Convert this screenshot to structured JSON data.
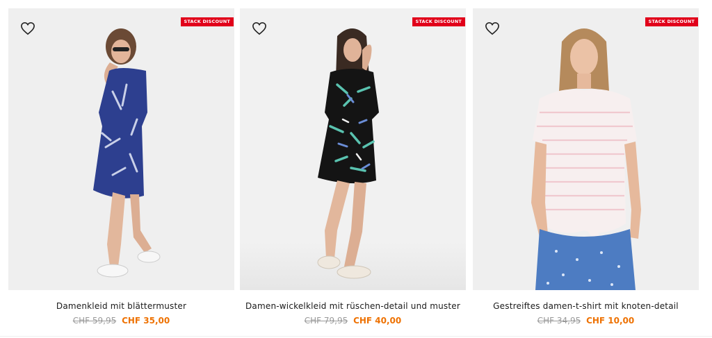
{
  "products": [
    {
      "badge": "STACK DISCOUNT",
      "name": "Damenkleid mit blättermuster",
      "old_price": "CHF 59,95",
      "new_price": "CHF 35,00"
    },
    {
      "badge": "STACK DISCOUNT",
      "name": "Damen-wickelkleid mit rüschen-detail und muster",
      "old_price": "CHF 79,95",
      "new_price": "CHF 40,00"
    },
    {
      "badge": "STACK DISCOUNT",
      "name": "Gestreiftes damen-t-shirt mit knoten-detail",
      "old_price": "CHF 34,95",
      "new_price": "CHF 10,00"
    }
  ],
  "icons": {
    "favorite": "heart-outline-icon"
  },
  "colors": {
    "badge_bg": "#e1001a",
    "sale_price": "#ee7203",
    "old_price": "#999999",
    "photo_bg": "#efefef"
  }
}
